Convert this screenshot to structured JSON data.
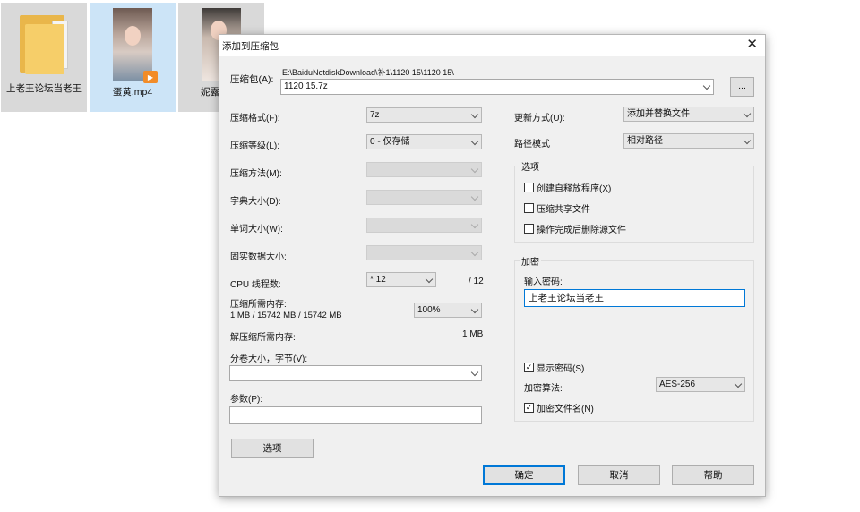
{
  "desktop": {
    "files": [
      {
        "label": "上老王论坛当老王"
      },
      {
        "label": "蛋黄.mp4"
      },
      {
        "label": "妮露"
      }
    ]
  },
  "dialog": {
    "title": "添加到压缩包",
    "archive": {
      "label": "压缩包(A):",
      "path": "E:\\BaiduNetdiskDownload\\补1\\1120 15\\1120 15\\",
      "value": "1120 15.7z",
      "browse_label": "..."
    },
    "format": {
      "label": "压缩格式(F):",
      "value": "7z"
    },
    "level": {
      "label": "压缩等级(L):",
      "value": "0 - 仅存储"
    },
    "method": {
      "label": "压缩方法(M):"
    },
    "dict_size": {
      "label": "字典大小(D):"
    },
    "word_size": {
      "label": "单词大小(W):"
    },
    "solid_size": {
      "label": "固实数据大小:"
    },
    "cpu_threads": {
      "label": "CPU 线程数:",
      "value": "* 12",
      "max": "/ 12"
    },
    "mem_compress": {
      "label": "压缩所需内存:",
      "detail": "1 MB / 15742 MB / 15742 MB",
      "percent": "100%"
    },
    "mem_decompress": {
      "label": "解压缩所需内存:",
      "value": "1 MB"
    },
    "volume": {
      "label": "分卷大小，字节(V):",
      "value": ""
    },
    "params": {
      "label": "参数(P):",
      "value": ""
    },
    "options_button": "选项",
    "update_mode": {
      "label": "更新方式(U):",
      "value": "添加并替换文件"
    },
    "path_mode": {
      "label": "路径模式",
      "value": "相对路径"
    },
    "options_group": {
      "title": "选项",
      "items": [
        {
          "label": "创建自释放程序(X)",
          "checked": false
        },
        {
          "label": "压缩共享文件",
          "checked": false
        },
        {
          "label": "操作完成后删除源文件",
          "checked": false
        }
      ]
    },
    "encryption": {
      "title": "加密",
      "password_label": "输入密码:",
      "password_value": "上老王论坛当老王",
      "show_password": {
        "label": "显示密码(S)",
        "checked": true
      },
      "method_label": "加密算法:",
      "method_value": "AES-256",
      "encrypt_names": {
        "label": "加密文件名(N)",
        "checked": true
      }
    },
    "buttons": {
      "ok": "确定",
      "cancel": "取消",
      "help": "帮助"
    }
  }
}
